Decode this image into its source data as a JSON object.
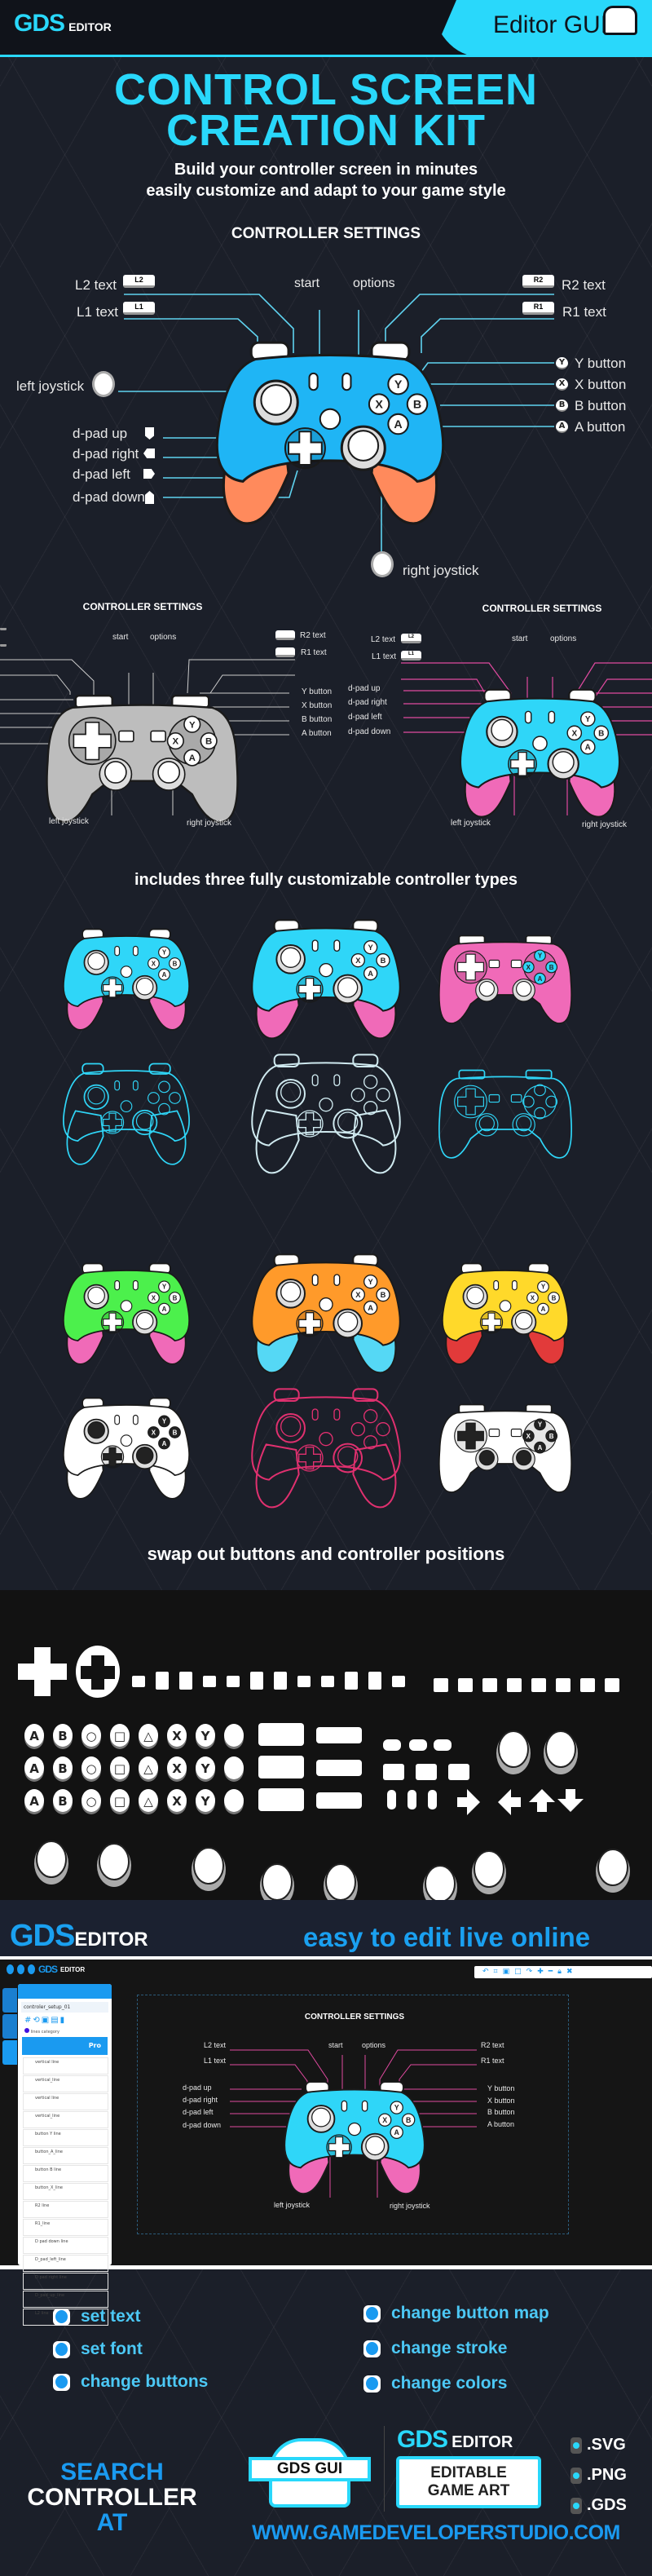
{
  "header": {
    "logo_main": "GDS",
    "logo_sub": "EDITOR",
    "product": "Editor GUI",
    "icon": "document-icon"
  },
  "hero": {
    "title_line1": "CONTROL SCREEN",
    "title_line2": "CREATION  KIT",
    "subtitle_line1": "Build your controller screen in minutes",
    "subtitle_line2": "easily customize and adapt to your game style"
  },
  "colors": {
    "accent": "#29d8fb",
    "blue": "#1a9af0",
    "bg": "#1b1f29",
    "line_main": "#5fd3f0",
    "line_pink": "#e04aa0"
  },
  "main_diagram": {
    "title": "CONTROLLER SETTINGS",
    "l2_text": "L2 text",
    "l1_text": "L1 text",
    "l2_badge": "L2",
    "l1_badge": "L1",
    "r2_badge": "R2",
    "r1_badge": "R1",
    "start": "start",
    "options": "options",
    "r2_text": "R2 text",
    "r1_text": "R1 text",
    "left_joystick": "left joystick",
    "right_joystick": "right joystick",
    "dpad_up": "d-pad up",
    "dpad_right": "d-pad right",
    "dpad_left": "d-pad left",
    "dpad_down": "d-pad down",
    "y_button": "Y button",
    "x_button": "X button",
    "b_button": "B button",
    "a_button": "A button",
    "y": "Y",
    "x": "X",
    "b": "B",
    "a": "A"
  },
  "small_diagrams": [
    {
      "title": "CONTROLLER SETTINGS",
      "start": "start",
      "options": "options",
      "r2_text": "R2 text",
      "r1_text": "R1 text",
      "y_button": "Y button",
      "x_button": "X button",
      "b_button": "B button",
      "a_button": "A button",
      "left_joystick": "left joystick",
      "right_joystick": "right joystick"
    },
    {
      "title": "CONTROLLER SETTINGS",
      "l2_text": "L2 text",
      "l1_text": "L1 text",
      "l2_badge": "L2",
      "l1_badge": "L1",
      "start": "start",
      "options": "options",
      "dpad_up": "d-pad up",
      "dpad_right": "d-pad right",
      "dpad_left": "d-pad left",
      "dpad_down": "d-pad down",
      "left_joystick": "left joystick",
      "right_joystick": "right joystick"
    }
  ],
  "types_heading": "includes three fully customizable controller types",
  "controller_variants": [
    {
      "type": "xbox",
      "body": "#2fd6f8",
      "grip": "#f06ab8",
      "mode": "fill"
    },
    {
      "type": "xbox",
      "body": "#2fd6f8",
      "grip": "#f06ab8",
      "mode": "fill"
    },
    {
      "type": "ps",
      "body": "#f06ab8",
      "grip": "#f06ab8",
      "btn": "#2fd6f8",
      "mode": "fill"
    },
    {
      "type": "xbox",
      "body": "#2fd6f8",
      "grip": "#2fd6f8",
      "mode": "line"
    },
    {
      "type": "xbox",
      "body": "#cfe9ef",
      "grip": "#cfe9ef",
      "mode": "line"
    },
    {
      "type": "ps",
      "body": "#2fd6f8",
      "grip": "#2fd6f8",
      "mode": "line"
    },
    {
      "type": "xbox",
      "body": "#4cf04c",
      "grip": "#f06ab8",
      "mode": "fill"
    },
    {
      "type": "xbox",
      "body": "#ff9a2a",
      "grip": "#55d8f5",
      "mode": "fill"
    },
    {
      "type": "xbox",
      "body": "#ffd92a",
      "grip": "#e23a3a",
      "mode": "fill"
    },
    {
      "type": "xbox",
      "body": "#ffffff",
      "grip": "#ffffff",
      "btn": "#222",
      "mode": "fill"
    },
    {
      "type": "xbox",
      "body": "#e0306f",
      "grip": "#e0306f",
      "mode": "line"
    },
    {
      "type": "ps",
      "body": "#ffffff",
      "grip": "#ffffff",
      "btn": "#222",
      "mode": "fill"
    }
  ],
  "swap_heading": "swap out buttons and controller positions",
  "face_button_labels": [
    "A",
    "B",
    "○",
    "□",
    "△",
    "X",
    "Y",
    ""
  ],
  "editor": {
    "logo_main": "GDS",
    "logo_sub": "EDITOR",
    "tagline": "easy to edit live online",
    "file_name": "controler_setup_01",
    "category": "lines category",
    "pro_tab": "Pro",
    "layers": [
      "vertical line",
      "vertical_line",
      "vertical line",
      "vertical_line",
      "button Y line",
      "button_A_line",
      "button B line",
      "button_X_line",
      "R2 line",
      "R1_line",
      "D pad down line",
      "D_pad_left_line",
      "D pad right line",
      "D_pad_up_line",
      "L2 line"
    ],
    "canvas": {
      "title": "CONTROLLER SETTINGS",
      "l2_text": "L2 text",
      "l1_text": "L1 text",
      "start": "start",
      "options": "options",
      "r2_text": "R2 text",
      "r1_text": "R1 text",
      "dpad_up": "d-pad up",
      "dpad_right": "d-pad right",
      "dpad_left": "d-pad left",
      "dpad_down": "d-pad down",
      "y_button": "Y button",
      "x_button": "X button",
      "b_button": "B button",
      "a_button": "A button",
      "left_joystick": "left joystick",
      "right_joystick": "right joystick"
    }
  },
  "features": {
    "left": [
      "set text",
      "set font",
      "change buttons"
    ],
    "right": [
      "change button map",
      "change stroke",
      "change colors"
    ]
  },
  "footer": {
    "search": "SEARCH",
    "controller": "CONTROLLER",
    "at": "AT",
    "gui_badge": "GDS GUI",
    "editor_main": "GDS",
    "editor_sub": "EDITOR",
    "editable_line1": "EDITABLE",
    "editable_line2": "GAME ART",
    "formats": [
      ".SVG",
      ".PNG",
      ".GDS"
    ],
    "url": "WWW.GAMEDEVELOPERSTUDIO.COM"
  }
}
